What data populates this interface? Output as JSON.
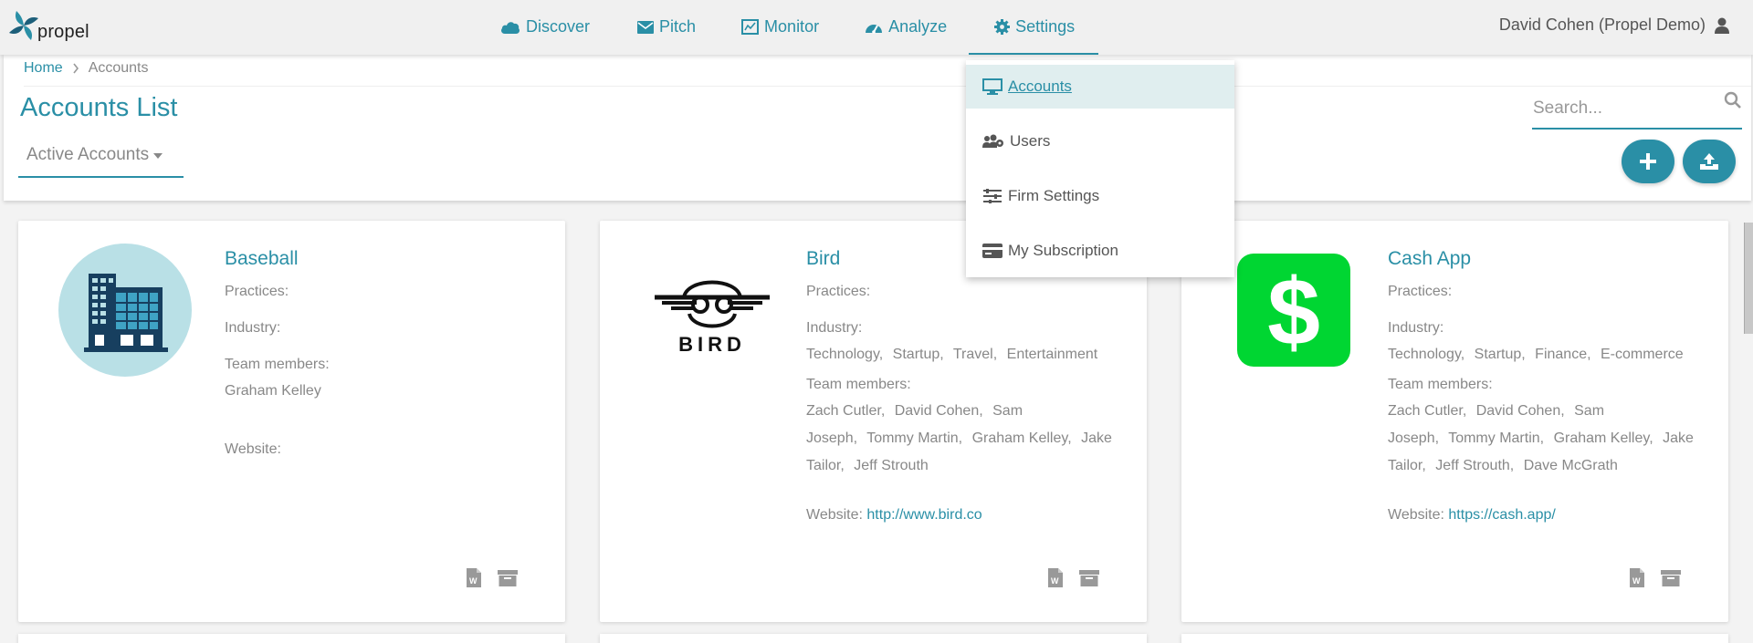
{
  "app": {
    "logo_text": "propel",
    "user_name": "David Cohen (Propel Demo)"
  },
  "nav": [
    {
      "label": "Discover",
      "icon": "cloud-icon"
    },
    {
      "label": "Pitch",
      "icon": "envelope-icon"
    },
    {
      "label": "Monitor",
      "icon": "monitor-chart-icon"
    },
    {
      "label": "Analyze",
      "icon": "gauge-icon"
    },
    {
      "label": "Settings",
      "icon": "gear-icon",
      "active": true
    }
  ],
  "breadcrumb": {
    "home": "Home",
    "current": "Accounts"
  },
  "page": {
    "title": "Accounts List",
    "filter_label": "Active Accounts",
    "search_placeholder": "Search..."
  },
  "settings_menu": [
    {
      "label": "Accounts",
      "icon": "desktop-icon",
      "active": true
    },
    {
      "label": "Users",
      "icon": "users-gear-icon"
    },
    {
      "label": "Firm Settings",
      "icon": "sliders-icon"
    },
    {
      "label": "My Subscription",
      "icon": "credit-card-icon"
    }
  ],
  "labels": {
    "practices": "Practices:",
    "industry": "Industry:",
    "team_members": "Team members:",
    "website": "Website:"
  },
  "accounts": [
    {
      "name": "Baseball",
      "industry": [],
      "team": [
        "Graham Kelley"
      ],
      "website": "",
      "logo": "building-icon"
    },
    {
      "name": "Bird",
      "industry": [
        "Technology",
        "Startup",
        "Travel",
        "Entertainment"
      ],
      "team_lines": [
        [
          "Zach Cutler",
          "David Cohen",
          "Sam"
        ],
        [
          "Joseph",
          "Tommy Martin",
          "Graham Kelley",
          "Jake"
        ],
        [
          "Tailor",
          "Jeff Strouth"
        ]
      ],
      "website": "http://www.bird.co",
      "logo": "bird-logo",
      "logo_text": "BIRD"
    },
    {
      "name": "Cash App",
      "industry": [
        "Technology",
        "Startup",
        "Finance",
        "E-commerce"
      ],
      "team_lines": [
        [
          "Zach Cutler",
          "David Cohen",
          "Sam"
        ],
        [
          "Joseph",
          "Tommy Martin",
          "Graham Kelley",
          "Jake"
        ],
        [
          "Tailor",
          "Jeff Strouth",
          "Dave McGrath"
        ]
      ],
      "website": "https://cash.app/",
      "logo": "cash-app-logo"
    }
  ],
  "colors": {
    "accent": "#2a8fa6",
    "cash_green": "#00d632",
    "building_bg": "#b9e0e6",
    "building_dark": "#173f5f"
  }
}
